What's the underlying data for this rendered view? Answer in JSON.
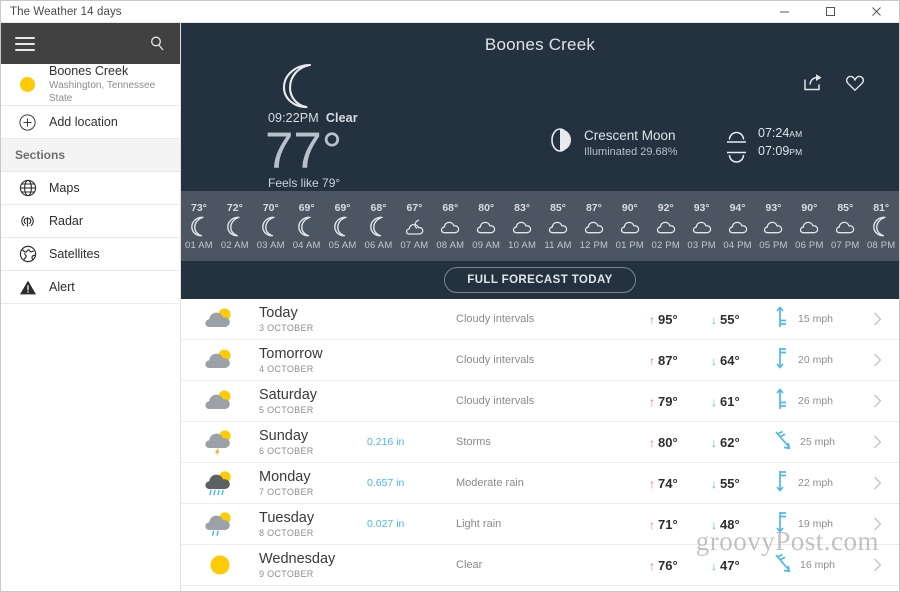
{
  "window": {
    "title": "The Weather 14 days",
    "minimize_label": "minimize",
    "maximize_label": "maximize",
    "close_label": "close"
  },
  "sidebar": {
    "menu_icon": "hamburger-icon",
    "search_icon": "search-icon",
    "location": {
      "name": "Boones Creek",
      "region": "Washington, Tennessee State",
      "icon": "sun-icon"
    },
    "add_location_label": "Add location",
    "add_location_icon": "plus-circle-icon",
    "sections_header": "Sections",
    "items": [
      {
        "label": "Maps",
        "icon": "globe-grid-icon"
      },
      {
        "label": "Radar",
        "icon": "radar-signal-icon"
      },
      {
        "label": "Satellites",
        "icon": "satellite-globe-icon"
      },
      {
        "label": "Alert",
        "icon": "warning-triangle-icon"
      }
    ]
  },
  "hero": {
    "title": "Boones Creek",
    "share_icon": "share-icon",
    "favorite_icon": "heart-icon",
    "current": {
      "icon": "crescent-moon-icon",
      "time": "09:22PM",
      "condition": "Clear",
      "temperature": "77°",
      "feels_like": "Feels like 79°"
    },
    "moon": {
      "icon": "moon-phase-icon",
      "phase": "Crescent Moon",
      "illumination": "Illuminated 29.68%"
    },
    "sun": {
      "sunrise_icon": "sunrise-icon",
      "sunset_icon": "sunset-icon",
      "sunrise_time": "07:24",
      "sunrise_meridiem": "AM",
      "sunset_time": "07:09",
      "sunset_meridiem": "PM"
    }
  },
  "hourly": [
    {
      "temp": "73°",
      "time": "01 AM",
      "icon": "moon-icon"
    },
    {
      "temp": "72°",
      "time": "02 AM",
      "icon": "moon-icon"
    },
    {
      "temp": "70°",
      "time": "03 AM",
      "icon": "moon-icon"
    },
    {
      "temp": "69°",
      "time": "04 AM",
      "icon": "moon-icon"
    },
    {
      "temp": "69°",
      "time": "05 AM",
      "icon": "moon-icon"
    },
    {
      "temp": "68°",
      "time": "06 AM",
      "icon": "moon-icon"
    },
    {
      "temp": "67°",
      "time": "07 AM",
      "icon": "cloud-moon-icon"
    },
    {
      "temp": "68°",
      "time": "08 AM",
      "icon": "cloud-sun-icon"
    },
    {
      "temp": "80°",
      "time": "09 AM",
      "icon": "cloud-sun-icon"
    },
    {
      "temp": "83°",
      "time": "10 AM",
      "icon": "cloud-sun-icon"
    },
    {
      "temp": "85°",
      "time": "11 AM",
      "icon": "cloud-sun-icon"
    },
    {
      "temp": "87°",
      "time": "12 PM",
      "icon": "cloud-sun-icon"
    },
    {
      "temp": "90°",
      "time": "01 PM",
      "icon": "cloud-sun-icon"
    },
    {
      "temp": "92°",
      "time": "02 PM",
      "icon": "cloud-sun-icon"
    },
    {
      "temp": "93°",
      "time": "03 PM",
      "icon": "cloud-sun-icon"
    },
    {
      "temp": "94°",
      "time": "04 PM",
      "icon": "cloud-sun-icon"
    },
    {
      "temp": "93°",
      "time": "05 PM",
      "icon": "cloud-sun-icon"
    },
    {
      "temp": "90°",
      "time": "06 PM",
      "icon": "cloud-sun-icon"
    },
    {
      "temp": "85°",
      "time": "07 PM",
      "icon": "cloud-sun-icon"
    },
    {
      "temp": "81°",
      "time": "08 PM",
      "icon": "moon-icon"
    }
  ],
  "full_forecast_button": "FULL FORECAST TODAY",
  "forecast": [
    {
      "day": "Today",
      "date": "3 OCTOBER",
      "precip": "",
      "desc": "Cloudy intervals",
      "hi": "95°",
      "lo": "55°",
      "wind": "15 mph",
      "icon": "cloud-sun-icon",
      "wind_icon": "wind-barb-up-icon"
    },
    {
      "day": "Tomorrow",
      "date": "4 OCTOBER",
      "precip": "",
      "desc": "Cloudy intervals",
      "hi": "87°",
      "lo": "64°",
      "wind": "20 mph",
      "icon": "cloud-sun-icon",
      "wind_icon": "wind-barb-down-icon"
    },
    {
      "day": "Saturday",
      "date": "5 OCTOBER",
      "precip": "",
      "desc": "Cloudy intervals",
      "hi": "79°",
      "lo": "61°",
      "wind": "26 mph",
      "icon": "cloud-sun-icon",
      "wind_icon": "wind-barb-up-icon"
    },
    {
      "day": "Sunday",
      "date": "6 OCTOBER",
      "precip": "0.216 in",
      "desc": "Storms",
      "hi": "80°",
      "lo": "62°",
      "wind": "25 mph",
      "icon": "storm-icon",
      "wind_icon": "wind-barb-diagonal-icon"
    },
    {
      "day": "Monday",
      "date": "7 OCTOBER",
      "precip": "0.657 in",
      "desc": "Moderate rain",
      "hi": "74°",
      "lo": "55°",
      "wind": "22 mph",
      "icon": "heavy-rain-icon",
      "wind_icon": "wind-barb-down-icon"
    },
    {
      "day": "Tuesday",
      "date": "8 OCTOBER",
      "precip": "0.027 in",
      "desc": "Light rain",
      "hi": "71°",
      "lo": "48°",
      "wind": "19 mph",
      "icon": "light-rain-icon",
      "wind_icon": "wind-barb-down-icon"
    },
    {
      "day": "Wednesday",
      "date": "9 OCTOBER",
      "precip": "",
      "desc": "Clear",
      "hi": "76°",
      "lo": "47°",
      "wind": "16 mph",
      "icon": "sun-icon",
      "wind_icon": "wind-barb-diagonal-icon"
    }
  ],
  "watermark": "groovyPost.com",
  "colors": {
    "hero_bg": "#243240",
    "hourly_bg": "#4b5662",
    "sidebar_header_bg": "#414141",
    "accent_blue": "#4db8e8",
    "accent_red": "#e8736a",
    "sun_yellow": "#ffcb05",
    "cloud_gray": "#9aa1a8"
  }
}
